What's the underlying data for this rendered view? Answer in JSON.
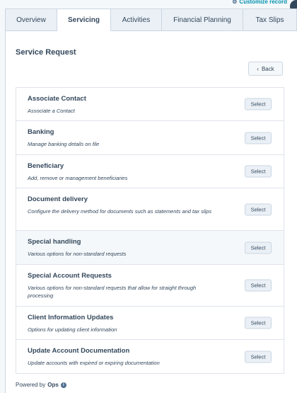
{
  "header": {
    "customize_label": "Customize record",
    "gear_icon": "gear-icon"
  },
  "tabs": [
    {
      "label": "Overview",
      "active": false
    },
    {
      "label": "Servicing",
      "active": true
    },
    {
      "label": "Activities",
      "active": false
    },
    {
      "label": "Financial Planning",
      "active": false
    },
    {
      "label": "Tax Slips",
      "active": false
    }
  ],
  "card": {
    "title": "Service Request",
    "back_label": "Back",
    "back_icon": "chevron-left-icon"
  },
  "requests": [
    {
      "title": "Associate Contact",
      "description": "Associate a Contact",
      "button": "Select"
    },
    {
      "title": "Banking",
      "description": "Manage banking details on file",
      "button": "Select"
    },
    {
      "title": "Beneficiary",
      "description": "Add, remove or management beneficiaries",
      "button": "Select"
    },
    {
      "title": "Document delivery",
      "description": "Configure the delivery method for documents such as statements and tax slips",
      "button": "Select"
    },
    {
      "title": "Special handling",
      "description": "Various options for non-standard requests",
      "button": "Select"
    },
    {
      "title": "Special Account Requests",
      "description": "Various options for non-standard requests that allow for straight through processing",
      "button": "Select"
    },
    {
      "title": "Client Information Updates",
      "description": "Options for updating client information",
      "button": "Select"
    },
    {
      "title": "Update Account Documentation",
      "description": "Update accounts with expired or expiring documentation",
      "button": "Select"
    }
  ],
  "footer": {
    "powered_prefix": "Powered by",
    "powered_brand": "Ops",
    "info_icon": "info-icon"
  },
  "colors": {
    "link": "#0091ae",
    "text": "#33475b",
    "border": "#cbd6e2",
    "tab_bg": "#eaf0f6",
    "page_bg": "#f5f8fa"
  }
}
